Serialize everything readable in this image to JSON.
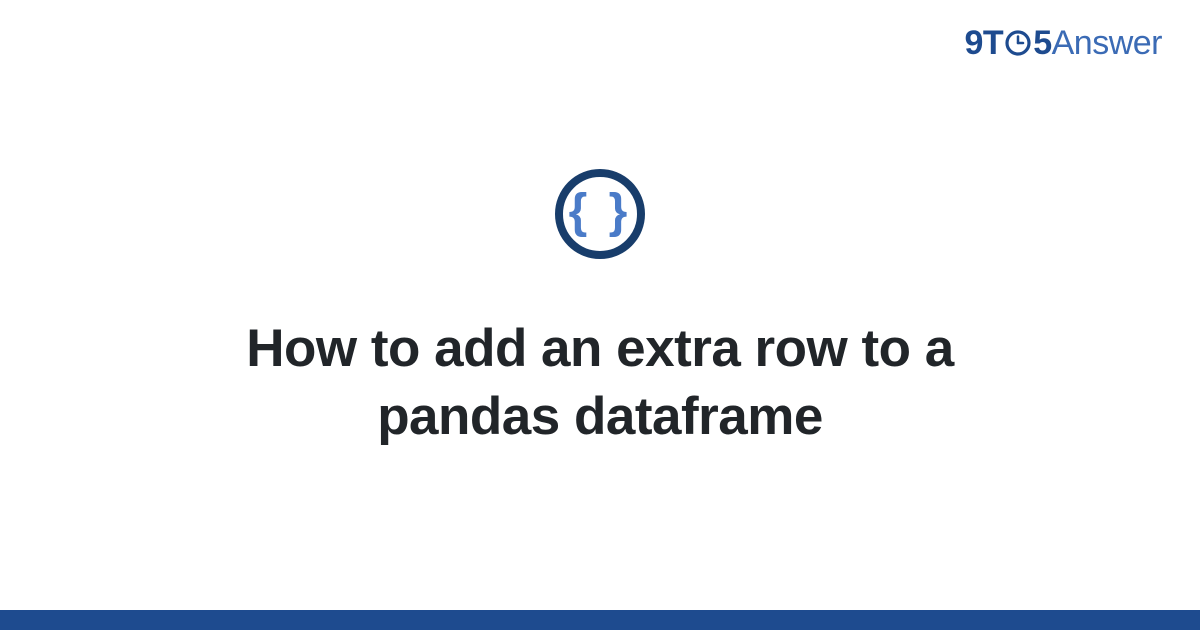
{
  "brand": {
    "nine": "9",
    "t": "T",
    "five": "5",
    "answer": "Answer"
  },
  "icon": {
    "braces": "{ }"
  },
  "title": "How to add an extra row to a pandas dataframe",
  "colors": {
    "brand_dark": "#1e4b8f",
    "brand_light": "#3b6bb5",
    "icon_ring": "#183d6b",
    "icon_braces": "#4a7bc8",
    "text": "#212529"
  }
}
